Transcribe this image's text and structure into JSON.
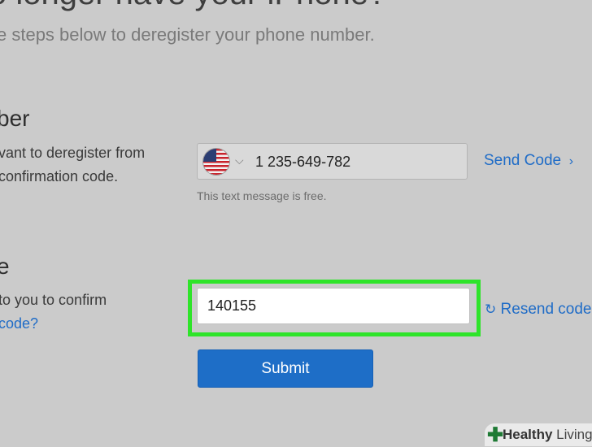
{
  "header": {
    "title": "o longer have your iPhone?",
    "subtitle": "e steps below to deregister your phone number."
  },
  "phone_section": {
    "heading": "ber",
    "desc_line1": "vant to deregister from",
    "desc_line2": "confirmation code.",
    "country_flag_icon": "us-flag-icon",
    "phone_value": "1 235-649-782",
    "send_code_label": "Send Code",
    "free_note": "This text message is free."
  },
  "code_section": {
    "heading": "e",
    "desc_line1": "to you to confirm",
    "desc_line2": "code?",
    "code_value": "140155",
    "resend_label": "Resend code"
  },
  "submit_label": "Submit",
  "watermark": {
    "brand": "Healthy",
    "brand2": "Living"
  },
  "colors": {
    "accent": "#1e6ec7",
    "highlight": "#2fe42a",
    "background": "#cbcbcb"
  }
}
